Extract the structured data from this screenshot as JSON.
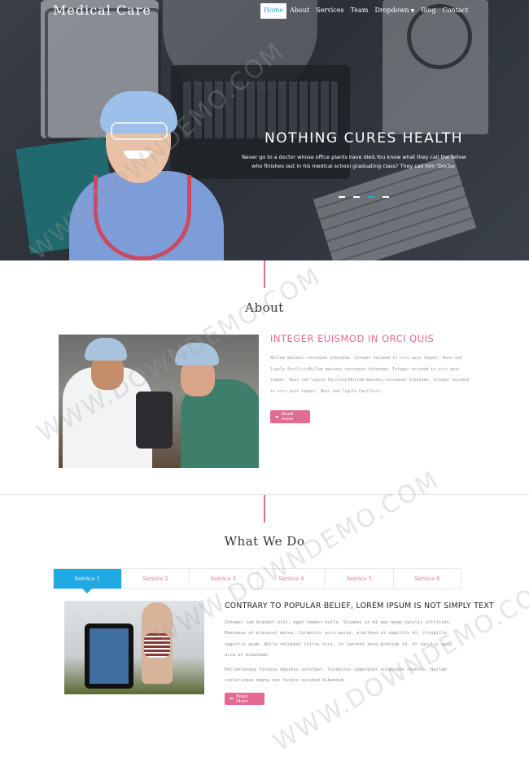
{
  "brand": "Medical Care",
  "nav": {
    "items": [
      "Home",
      "About",
      "Services",
      "Team",
      "Dropdown",
      "Blog",
      "Contact"
    ],
    "active": "Home"
  },
  "hero": {
    "title": "NOTHING CURES HEALTH",
    "text": "Never go to a doctor whose office plants have died.You know what they call the fellow who finishes last in his medical school graduating class? They call him 'Doctor.",
    "slides": 4,
    "active_slide": 3
  },
  "about": {
    "title": "About",
    "heading": "INTEGER EUISMOD IN ORCI QUIS",
    "text": "Nullam maximus consequat bibendum. Integer euismod in orci quis tempor. Nunc sed ligula facilisisNullam maximus consequat bibendum. Integer euismod in orci quis tempor. Nunc sed ligula FacilisisNullam maximus consequat bibendum. Integer euismod in orci quis tempor. Nunc sed ligula Facilisis",
    "button": "Read more"
  },
  "services": {
    "title": "What We Do",
    "tabs": [
      "Service 1",
      "Service 2",
      "Service 3",
      "Service 4",
      "Service 5",
      "Service 6"
    ],
    "active_tab": "Service 1",
    "heading": "CONTRARY TO POPULAR BELIEF, LOREM IPSUM IS NOT SIMPLY TEXT",
    "text1": "Integer sed blandit nisl, eget tempor nulla. Vivamus ut mi nec quam iaculis ultricies. Maecenas at placerat metus. Curabitur arcu purus, eleifend ut sagittis et, fringilla sagittis quam. Nulla volutpat tellus orci, in laoreet ante pretium id. Ut iaculis quis arcu et bibendum.",
    "text2": "Pellentesque finibus dapibus volutpat. Curabitur imperdiet vulputate rhoncus. Nullam scelerisque magna non turpis euismod bibendum.",
    "button": "Read More"
  },
  "watermark": "WWW.DOWNDEMO.COM",
  "colors": {
    "accent_blue": "#21a9e1",
    "accent_pink": "#e36a90"
  },
  "icons": {
    "button_icon": "share-icon",
    "nav_caret": "chevron-down-icon"
  }
}
